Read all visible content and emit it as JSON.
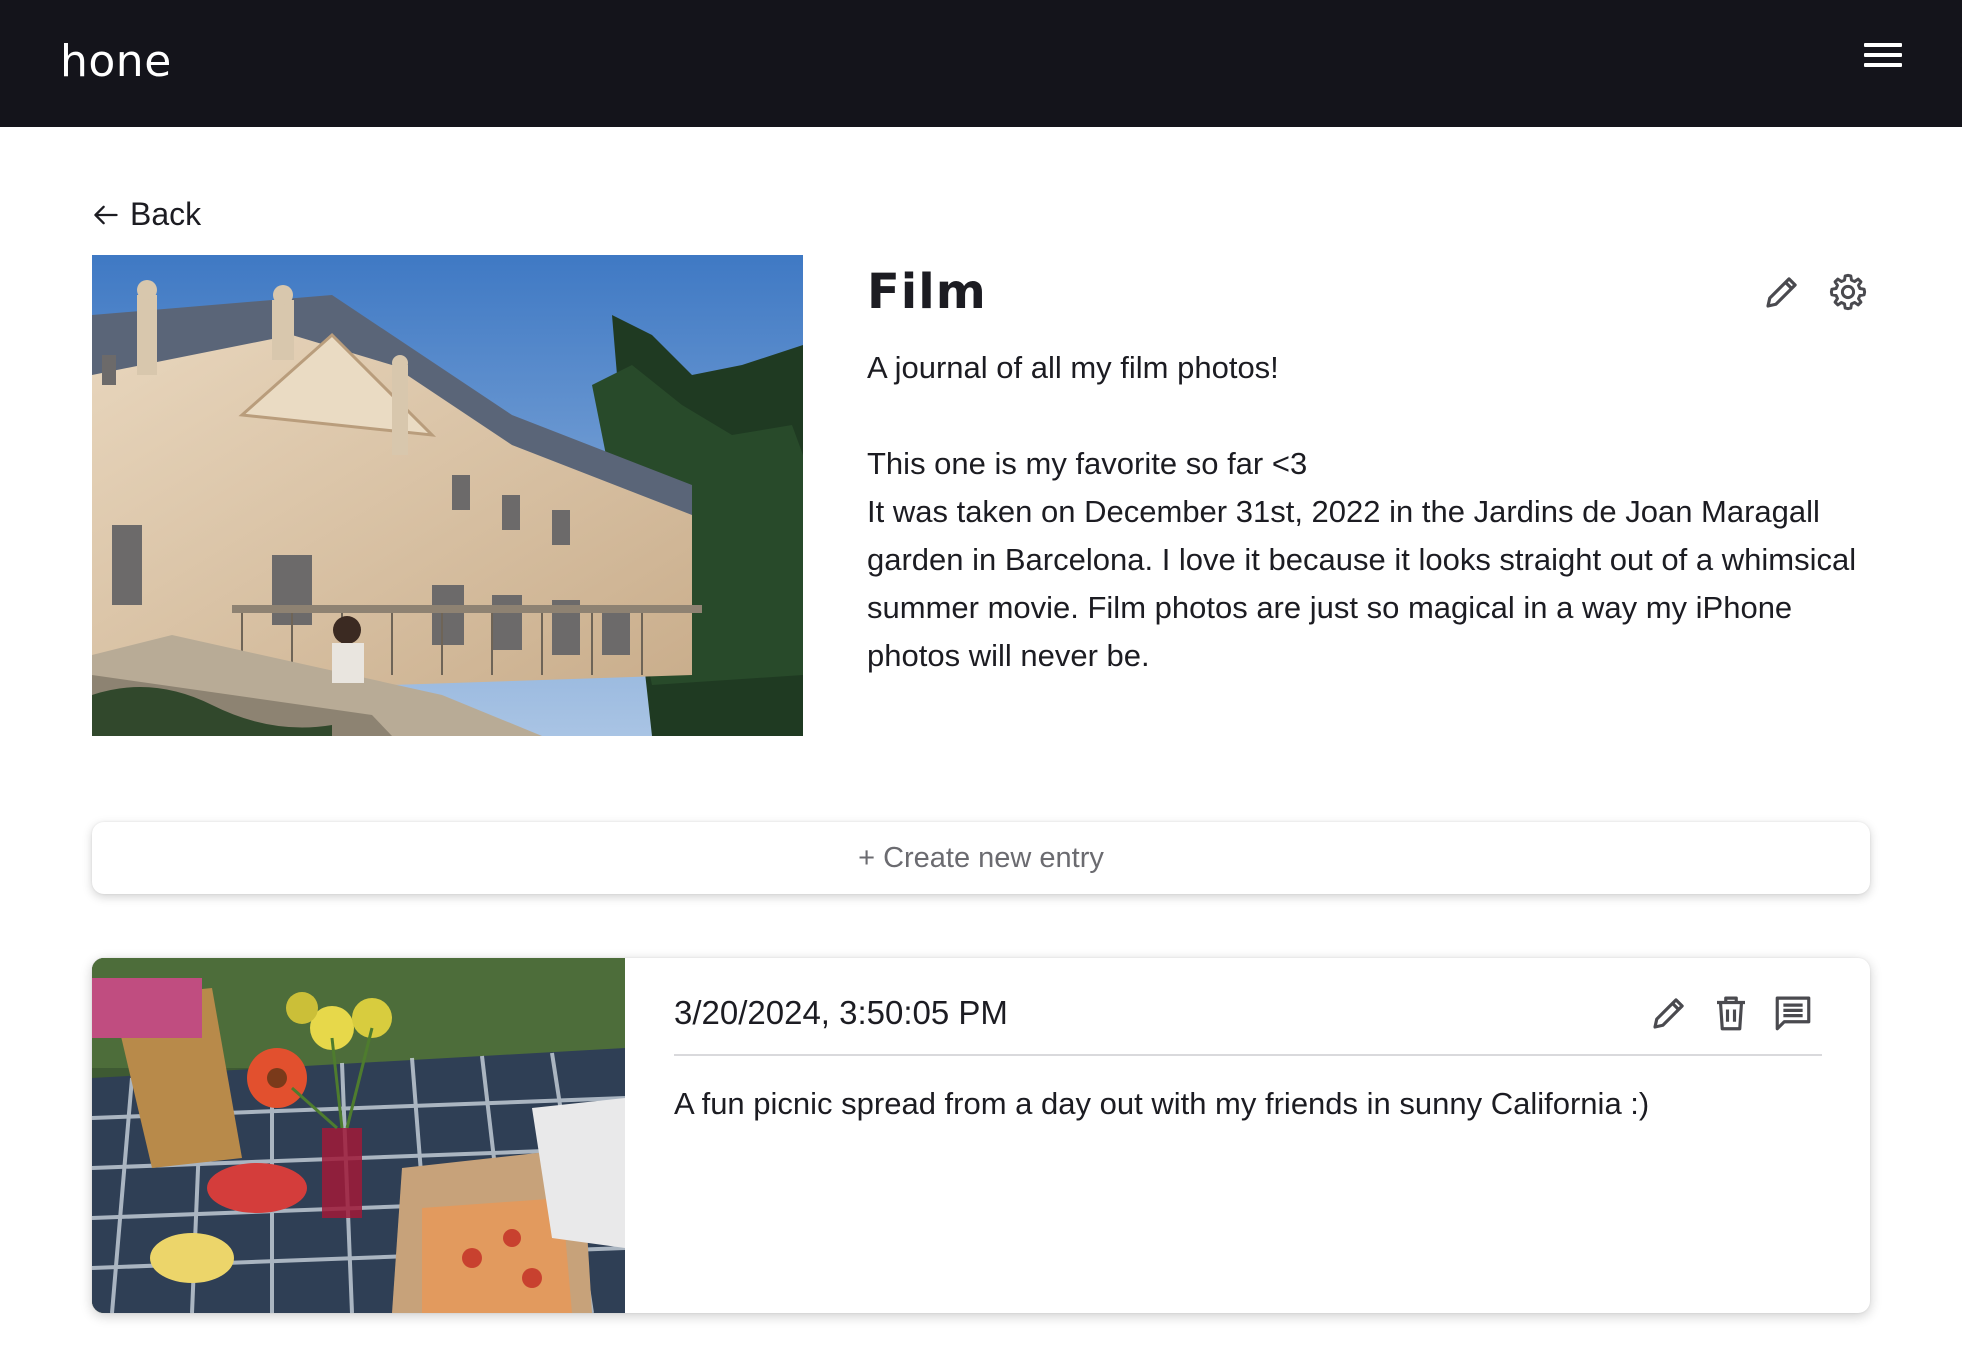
{
  "app": {
    "name": "hone"
  },
  "nav": {
    "back_label": "Back"
  },
  "journal": {
    "title": "Film",
    "description_lines": [
      "A journal of all my film photos!",
      "",
      "This one is my favorite so far <3",
      "It was taken on December 31st, 2022 in the Jardins de Joan Maragall garden in Barcelona. I love it because it looks straight out of a whimsical summer movie. Film photos are just so magical in a way my iPhone photos will never be."
    ]
  },
  "create_entry": {
    "label": "+ Create new entry"
  },
  "entries": [
    {
      "date": "3/20/2024, 3:50:05 PM",
      "text": "A fun picnic spread from a day out with my friends in sunny California :)"
    }
  ],
  "colors": {
    "topbar": "#14141b",
    "text": "#1c1c22",
    "muted": "#6b6b70"
  },
  "icons": {
    "menu": "hamburger-icon",
    "back": "arrow-left-icon",
    "edit": "pencil-icon",
    "settings": "gear-icon",
    "delete": "trash-icon",
    "comments": "comment-icon"
  }
}
